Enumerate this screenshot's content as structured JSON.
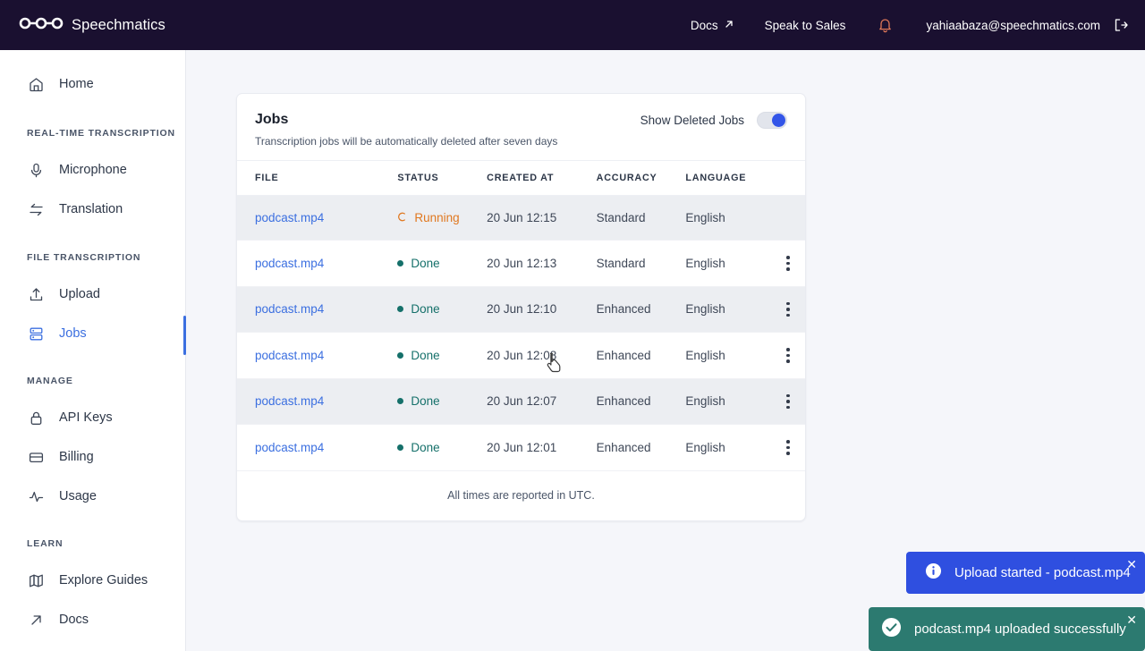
{
  "header": {
    "brand": "Speechmatics",
    "logo_icon": "speechmatics-logo",
    "docs_label": "Docs",
    "docs_icon": "external-link-arrow-icon",
    "sales_label": "Speak to Sales",
    "bell_icon": "notification-bell-icon",
    "bell_color": "#e07858",
    "email": "yahiaabaza@speechmatics.com",
    "logout_icon": "logout-icon",
    "background": "#1a1030"
  },
  "sidebar": {
    "groups": [
      {
        "label": "",
        "items": [
          {
            "label": "Home",
            "icon": "home-icon",
            "active": false
          }
        ]
      },
      {
        "label": "REAL-TIME TRANSCRIPTION",
        "items": [
          {
            "label": "Microphone",
            "icon": "microphone-icon",
            "active": false
          },
          {
            "label": "Translation",
            "icon": "translation-arrows-icon",
            "active": false
          }
        ]
      },
      {
        "label": "FILE TRANSCRIPTION",
        "items": [
          {
            "label": "Upload",
            "icon": "upload-icon",
            "active": false
          },
          {
            "label": "Jobs",
            "icon": "jobs-icon",
            "active": true
          }
        ]
      },
      {
        "label": "MANAGE",
        "items": [
          {
            "label": "API Keys",
            "icon": "lock-icon",
            "active": false
          },
          {
            "label": "Billing",
            "icon": "credit-card-icon",
            "active": false
          },
          {
            "label": "Usage",
            "icon": "activity-pulse-icon",
            "active": false
          }
        ]
      },
      {
        "label": "LEARN",
        "items": [
          {
            "label": "Explore Guides",
            "icon": "map-icon",
            "active": false
          },
          {
            "label": "Docs",
            "icon": "external-link-arrow-icon",
            "active": false
          }
        ]
      }
    ],
    "active_color": "#3b6fe0"
  },
  "jobs_card": {
    "title": "Jobs",
    "subtitle": "Transcription jobs will be automatically deleted after seven days",
    "toggle": {
      "label": "Show Deleted Jobs",
      "state": "on",
      "knob_color": "#3355e8"
    },
    "columns": [
      "FILE",
      "STATUS",
      "CREATED AT",
      "ACCURACY",
      "LANGUAGE"
    ],
    "rows": [
      {
        "file": "podcast.mp4",
        "status": "Running",
        "status_type": "running",
        "created_at": "20 Jun 12:15",
        "accuracy": "Standard",
        "language": "English",
        "has_menu": false,
        "shaded": true
      },
      {
        "file": "podcast.mp4",
        "status": "Done",
        "status_type": "done",
        "created_at": "20 Jun 12:13",
        "accuracy": "Standard",
        "language": "English",
        "has_menu": true,
        "shaded": false
      },
      {
        "file": "podcast.mp4",
        "status": "Done",
        "status_type": "done",
        "created_at": "20 Jun 12:10",
        "accuracy": "Enhanced",
        "language": "English",
        "has_menu": true,
        "shaded": true
      },
      {
        "file": "podcast.mp4",
        "status": "Done",
        "status_type": "done",
        "created_at": "20 Jun 12:08",
        "accuracy": "Enhanced",
        "language": "English",
        "has_menu": true,
        "shaded": false
      },
      {
        "file": "podcast.mp4",
        "status": "Done",
        "status_type": "done",
        "created_at": "20 Jun 12:07",
        "accuracy": "Enhanced",
        "language": "English",
        "has_menu": true,
        "shaded": true
      },
      {
        "file": "podcast.mp4",
        "status": "Done",
        "status_type": "done",
        "created_at": "20 Jun 12:01",
        "accuracy": "Enhanced",
        "language": "English",
        "has_menu": true,
        "shaded": false
      }
    ],
    "footer": "All times are reported in UTC.",
    "running_color": "#e07820",
    "done_color": "#15706a",
    "file_link_color": "#3b6fe0"
  },
  "toasts": [
    {
      "type": "info",
      "icon": "info-circle-icon",
      "message": "Upload started - podcast.mp4",
      "close_icon": "close-icon",
      "color": "#2f4fe0"
    },
    {
      "type": "success",
      "icon": "check-circle-icon",
      "message": "podcast.mp4 uploaded successfully",
      "close_icon": "close-icon",
      "color": "#2c7a70"
    }
  ],
  "cursor": {
    "icon": "pointer-hand-cursor"
  }
}
